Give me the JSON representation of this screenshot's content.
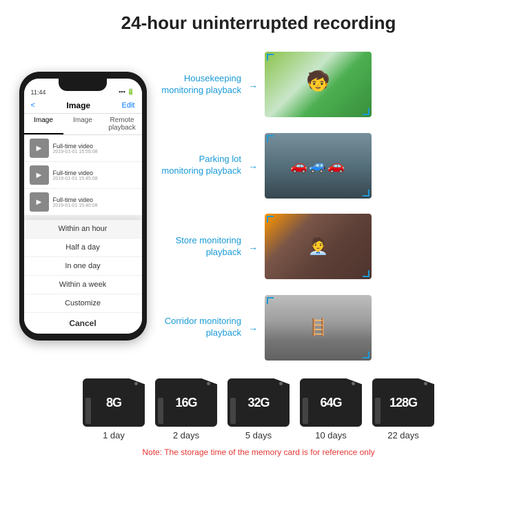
{
  "header": {
    "title": "24-hour uninterrupted recording"
  },
  "phone": {
    "time": "11:44",
    "nav": {
      "back": "<",
      "title": "Image",
      "edit": "Edit"
    },
    "tabs": [
      "Image",
      "Image",
      "Remote playback"
    ],
    "videos": [
      {
        "title": "Full-time video",
        "date": "2019-01-01 15:55:08"
      },
      {
        "title": "Full-time video",
        "date": "2019-01-01 15:45:08"
      },
      {
        "title": "Full-time video",
        "date": "2019-01-01 15:40:08"
      }
    ],
    "dropdown": {
      "items": [
        "Within an hour",
        "Half a day",
        "In one day",
        "Within a week",
        "Customize"
      ],
      "active": "Within an hour",
      "cancel": "Cancel"
    }
  },
  "scenes": [
    {
      "label": "Housekeeping\nmonitoring playback",
      "type": "housekeeping"
    },
    {
      "label": "Parking lot\nmonitoring playback",
      "type": "parking"
    },
    {
      "label": "Store monitoring\nplayback",
      "type": "store"
    },
    {
      "label": "Corridor monitoring\nplayback",
      "type": "corridor"
    }
  ],
  "storage": {
    "cards": [
      {
        "size": "8G",
        "days": "1 day"
      },
      {
        "size": "16G",
        "days": "2 days"
      },
      {
        "size": "32G",
        "days": "5 days"
      },
      {
        "size": "64G",
        "days": "10 days"
      },
      {
        "size": "128G",
        "days": "22 days"
      }
    ],
    "note": "Note: The storage time of the memory card is for reference only"
  }
}
